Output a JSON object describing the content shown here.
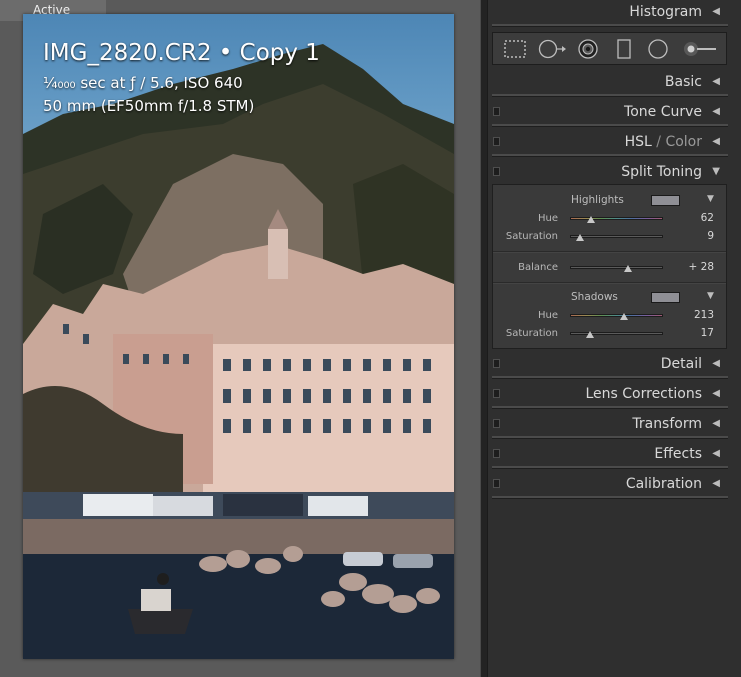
{
  "preview": {
    "tab_label": "Active",
    "overlay": {
      "title": "IMG_2820.CR2 • Copy 1",
      "exposure": "¹⁄₄₀₀₀ sec at ƒ / 5.6, ISO 640",
      "lens": "50 mm (EF50mm f/1.8 STM)"
    }
  },
  "panel": {
    "sections": {
      "histogram": "Histogram",
      "basic": "Basic",
      "tone_curve": "Tone Curve",
      "hsl": "HSL",
      "hsl_sep": " / ",
      "color": "Color",
      "split_toning": "Split Toning",
      "detail": "Detail",
      "lens_corrections": "Lens Corrections",
      "transform": "Transform",
      "effects": "Effects",
      "calibration": "Calibration"
    },
    "tools": [
      "crop-overlay-icon",
      "spot-removal-icon",
      "red-eye-icon",
      "graduated-filter-icon",
      "radial-filter-icon",
      "adjustment-brush-icon"
    ],
    "split_toning": {
      "highlights": {
        "title": "Highlights",
        "hue_label": "Hue",
        "hue_value": "62",
        "saturation_label": "Saturation",
        "saturation_value": "9"
      },
      "balance": {
        "label": "Balance",
        "value": "+ 28"
      },
      "shadows": {
        "title": "Shadows",
        "hue_label": "Hue",
        "hue_value": "213",
        "saturation_label": "Saturation",
        "saturation_value": "17"
      }
    }
  },
  "colors": {
    "panel_bg": "#2f2f2f",
    "preview_bg": "#5a5a5a",
    "swatch": "#8f8f95"
  }
}
